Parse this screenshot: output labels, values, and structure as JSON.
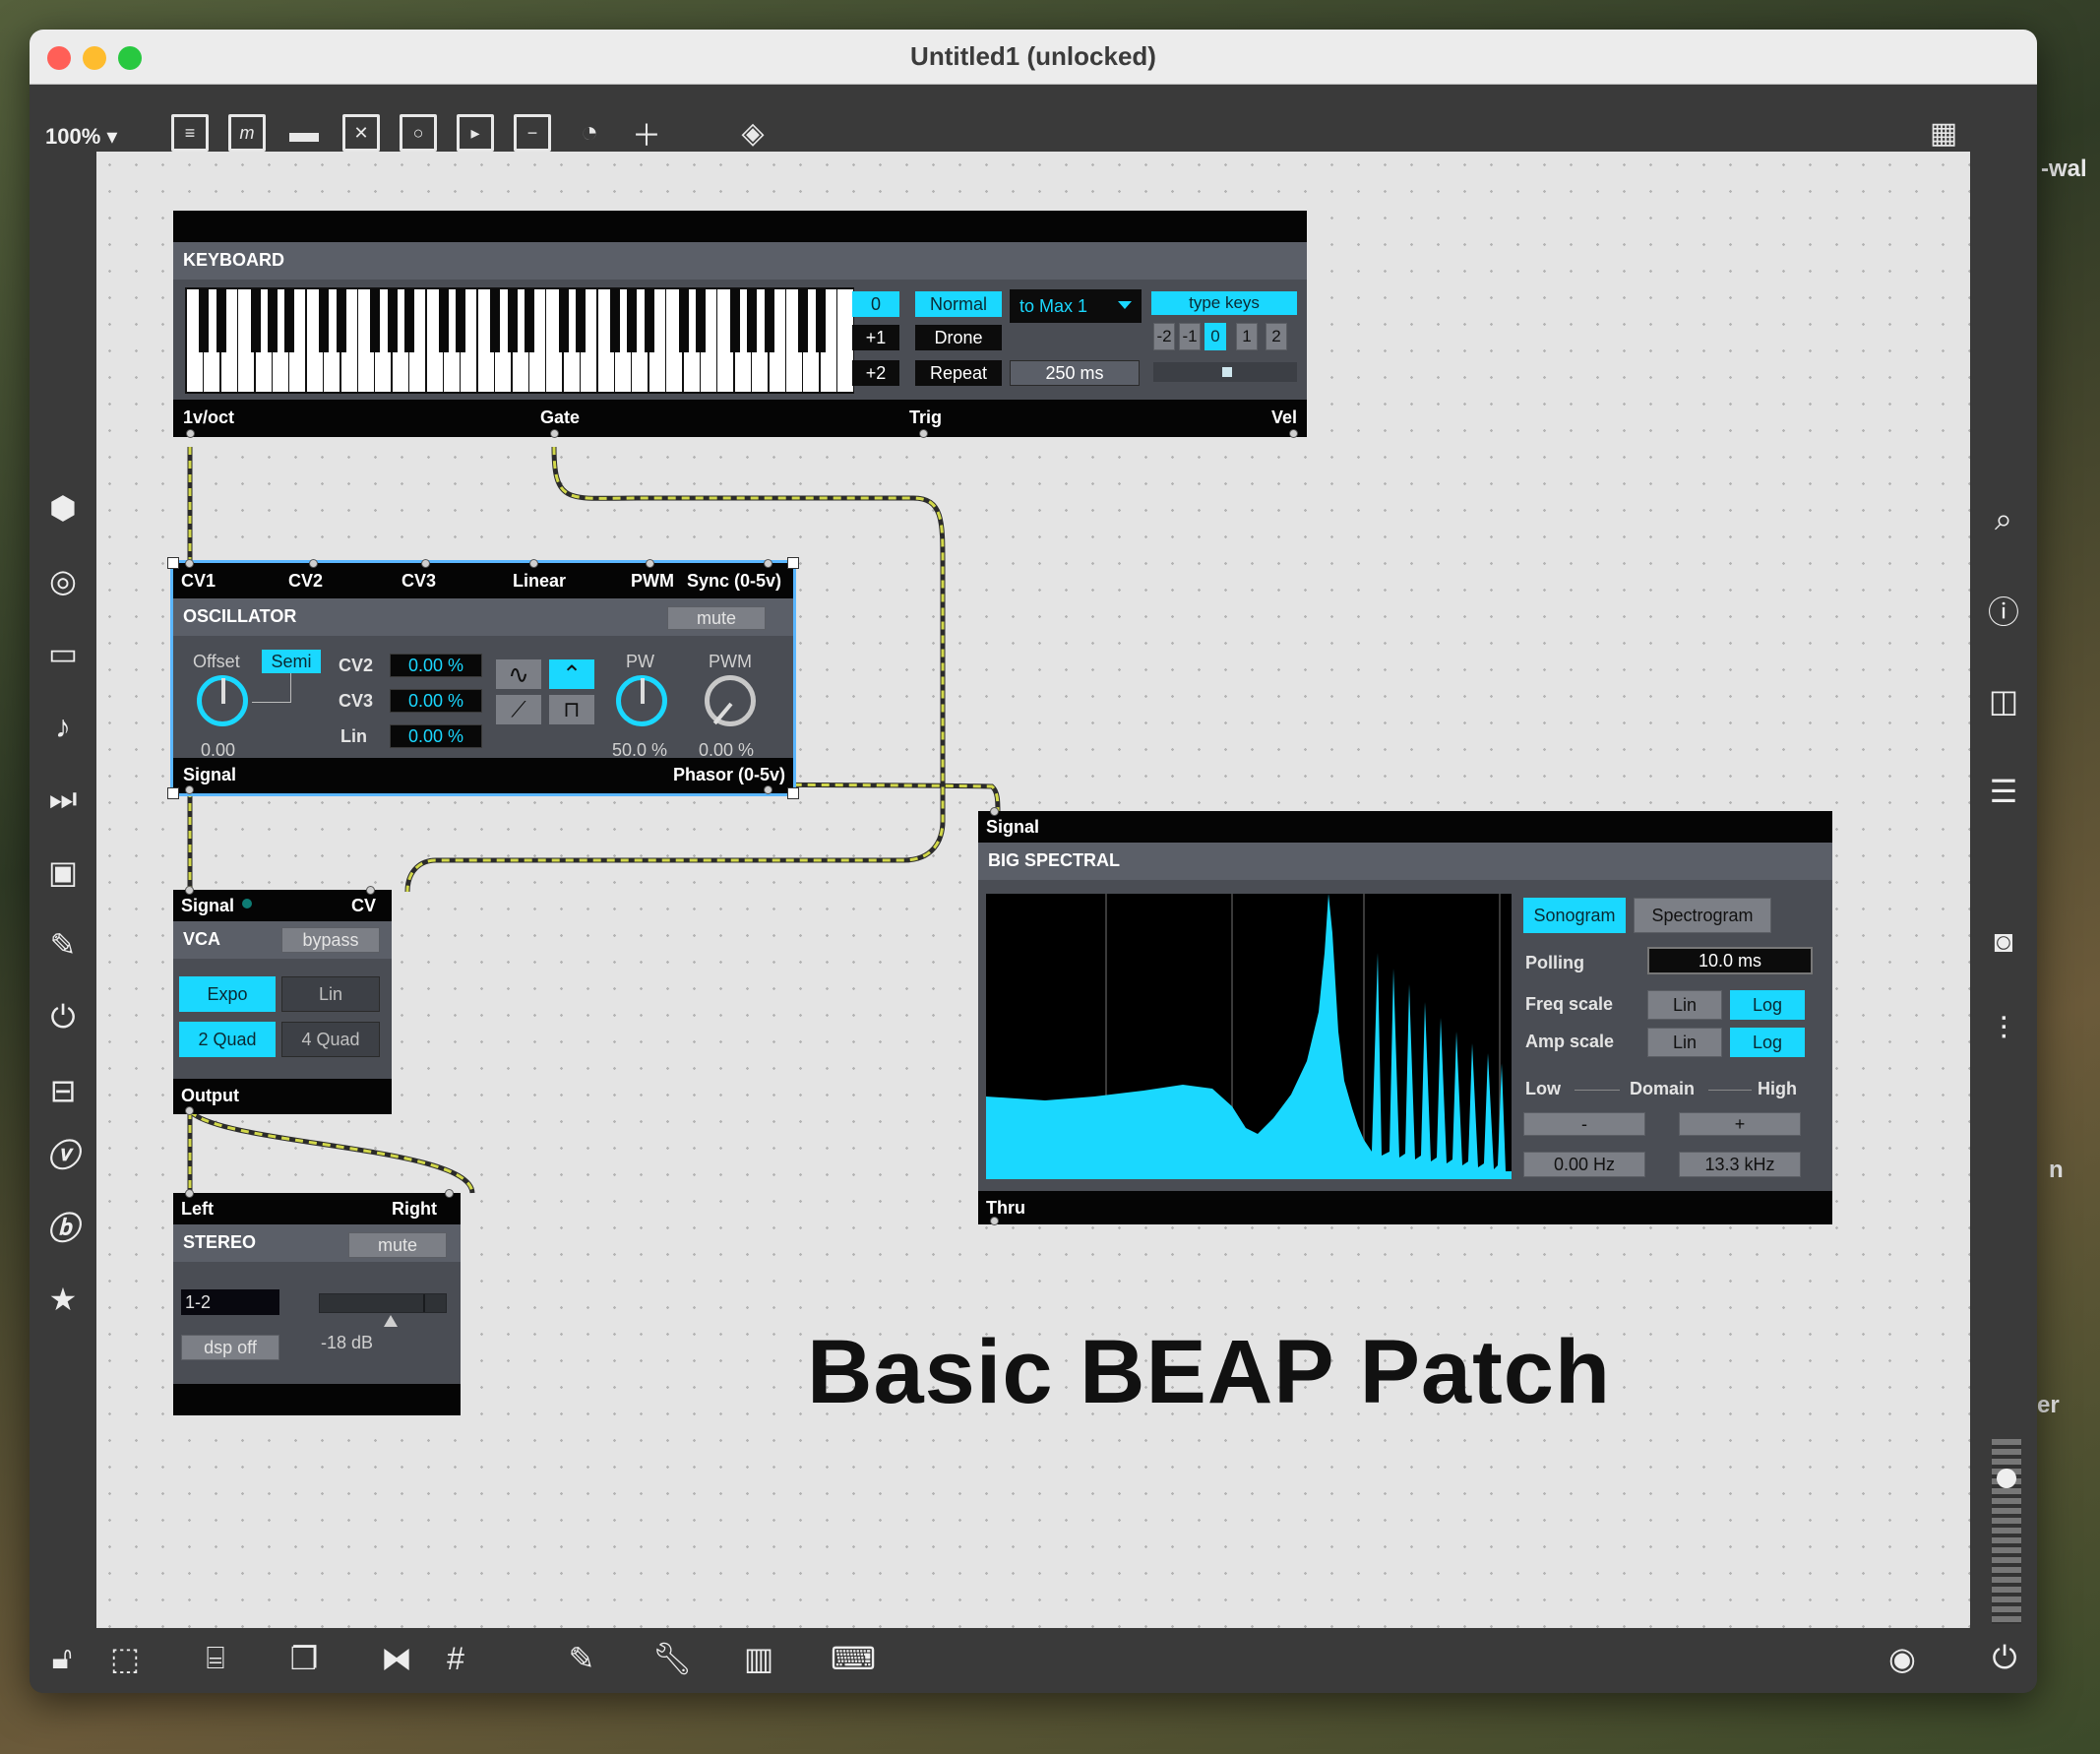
{
  "window": {
    "title": "Untitled1 (unlocked)"
  },
  "toolbar": {
    "zoom": "100% ▾"
  },
  "desktop": {
    "frag1": "-wal",
    "frag2": "n",
    "frag3": "er"
  },
  "keyboard": {
    "title": "KEYBOARD",
    "octave_values": [
      "0",
      "+1",
      "+2"
    ],
    "modes": [
      "Normal",
      "Drone",
      "Repeat"
    ],
    "device": "to Max 1",
    "repeat_time": "250 ms",
    "type_keys": "type keys",
    "octave_select": [
      "-2",
      "-1",
      "0",
      "1",
      "2"
    ],
    "outlets": [
      "1v/oct",
      "Gate",
      "Trig",
      "Vel"
    ]
  },
  "oscillator": {
    "title": "OSCILLATOR",
    "inlets": [
      "CV1",
      "CV2",
      "CV3",
      "Linear",
      "PWM",
      "Sync (0-5v)"
    ],
    "mute": "mute",
    "offset_label": "Offset",
    "semi": "Semi",
    "offset_value": "0.00",
    "cv_rows": [
      {
        "label": "CV2",
        "value": "0.00 %"
      },
      {
        "label": "CV3",
        "value": "0.00 %"
      },
      {
        "label": "Lin",
        "value": "0.00 %"
      }
    ],
    "pw_label": "PW",
    "pw_value": "50.0 %",
    "pwm_label": "PWM",
    "pwm_value": "0.00 %",
    "outlets": [
      "Signal",
      "Phasor (0-5v)"
    ]
  },
  "vca": {
    "title": "VCA",
    "inlets": [
      "Signal",
      "CV"
    ],
    "bypass": "bypass",
    "buttons": [
      "Expo",
      "Lin",
      "2 Quad",
      "4 Quad"
    ],
    "outlet": "Output"
  },
  "stereo": {
    "title": "STEREO",
    "inlets": [
      "Left",
      "Right"
    ],
    "mute": "mute",
    "channel": "1-2",
    "dsp": "dsp off",
    "gain": "-18 dB"
  },
  "spectral": {
    "title": "BIG SPECTRAL",
    "inlet": "Signal",
    "outlet": "Thru",
    "modes": [
      "Sonogram",
      "Spectrogram"
    ],
    "polling_label": "Polling",
    "polling_value": "10.0 ms",
    "freq_scale_label": "Freq scale",
    "amp_scale_label": "Amp scale",
    "scale_options": [
      "Lin",
      "Log"
    ],
    "domain_low": "Low",
    "domain_label": "Domain",
    "domain_high": "High",
    "minus": "-",
    "plus": "+",
    "low_value": "0.00 Hz",
    "high_value": "13.3 kHz"
  },
  "patch_comment": "Basic BEAP Patch",
  "colors": {
    "accent": "#1ad8ff",
    "cable": "#c9d24a"
  }
}
